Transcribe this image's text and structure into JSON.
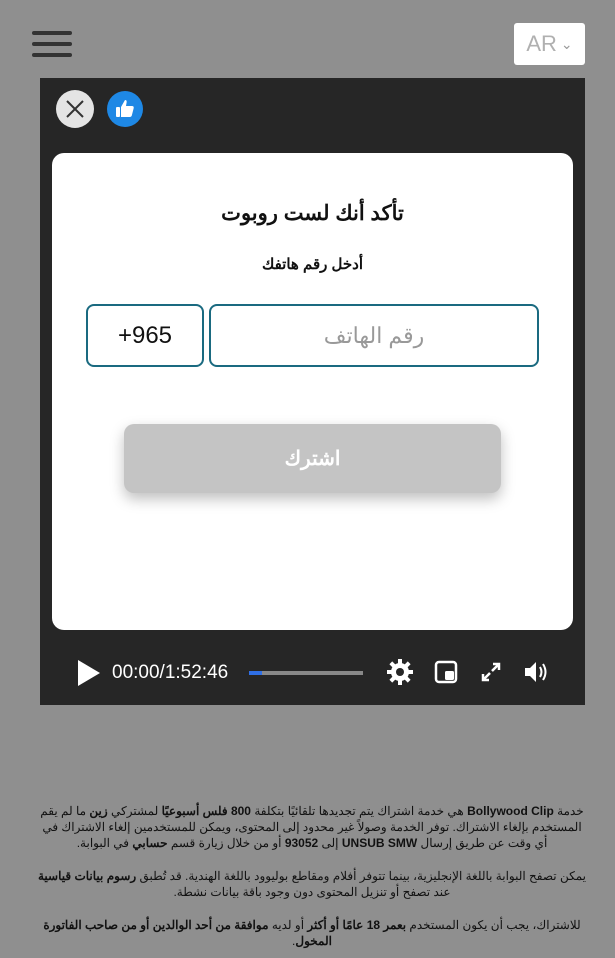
{
  "header": {
    "language": "AR",
    "icons": {
      "menu": "hamburger-menu-icon",
      "chevron": "chevron-down-icon"
    }
  },
  "player": {
    "icons": {
      "close": "close-icon",
      "like": "thumbs-up-icon"
    },
    "card": {
      "title": "تأكد أنك لست روبوت",
      "subtitle": "أدخل رقم هاتفك",
      "country_code": "+965",
      "phone_placeholder": "رقم الهاتف",
      "phone_value": "",
      "subscribe_label": "اشترك"
    },
    "controls": {
      "time": "00:00/1:52:46",
      "progress": 0.11,
      "icons": [
        "play-icon",
        "gear-icon",
        "picture-in-picture-icon",
        "fullscreen-icon",
        "volume-icon"
      ]
    }
  },
  "terms": {
    "p1": {
      "a": "خدمة ",
      "b": "Bollywood Clip",
      "c": " هي خدمة اشتراك يتم تجديدها تلقائيًا بتكلفة ",
      "d": "800 فلس أسبوعيًا",
      "e": " لمشتركي ",
      "f": "زين",
      "g": " ما لم يقم المستخدم بإلغاء الاشتراك. توفر الخدمة وصولاً غير محدود إلى المحتوى، ويمكن للمستخدمين إلغاء الاشتراك في أي وقت عن طريق إرسال ",
      "h": "UNSUB SMW",
      "i": " إلى ",
      "j": "93052",
      "k": " أو من خلال زيارة قسم ",
      "l": "حسابي",
      "m": " في البوابة."
    },
    "p2": {
      "a": "يمكن تصفح البوابة باللغة الإنجليزية، بينما تتوفر أفلام ومقاطع بوليوود باللغة الهندية. قد تُطبق ",
      "b": "رسوم بيانات قياسية",
      "c": " عند تصفح أو تنزيل المحتوى دون وجود باقة بيانات نشطة."
    },
    "p3": {
      "a": "للاشتراك، يجب أن يكون المستخدم ",
      "b": "بعمر 18 عامًا أو أكثر",
      "c": " أو لديه ",
      "d": "موافقة من أحد الوالدين أو من صاحب الفاتورة المخول",
      "e": "."
    }
  },
  "colors": {
    "background": "#8f8f8f",
    "player": "#262626",
    "accent": "#1a6a80",
    "like": "#1e88e5",
    "progress": "#2f6fe6",
    "button_disabled": "#c4c4c4"
  }
}
